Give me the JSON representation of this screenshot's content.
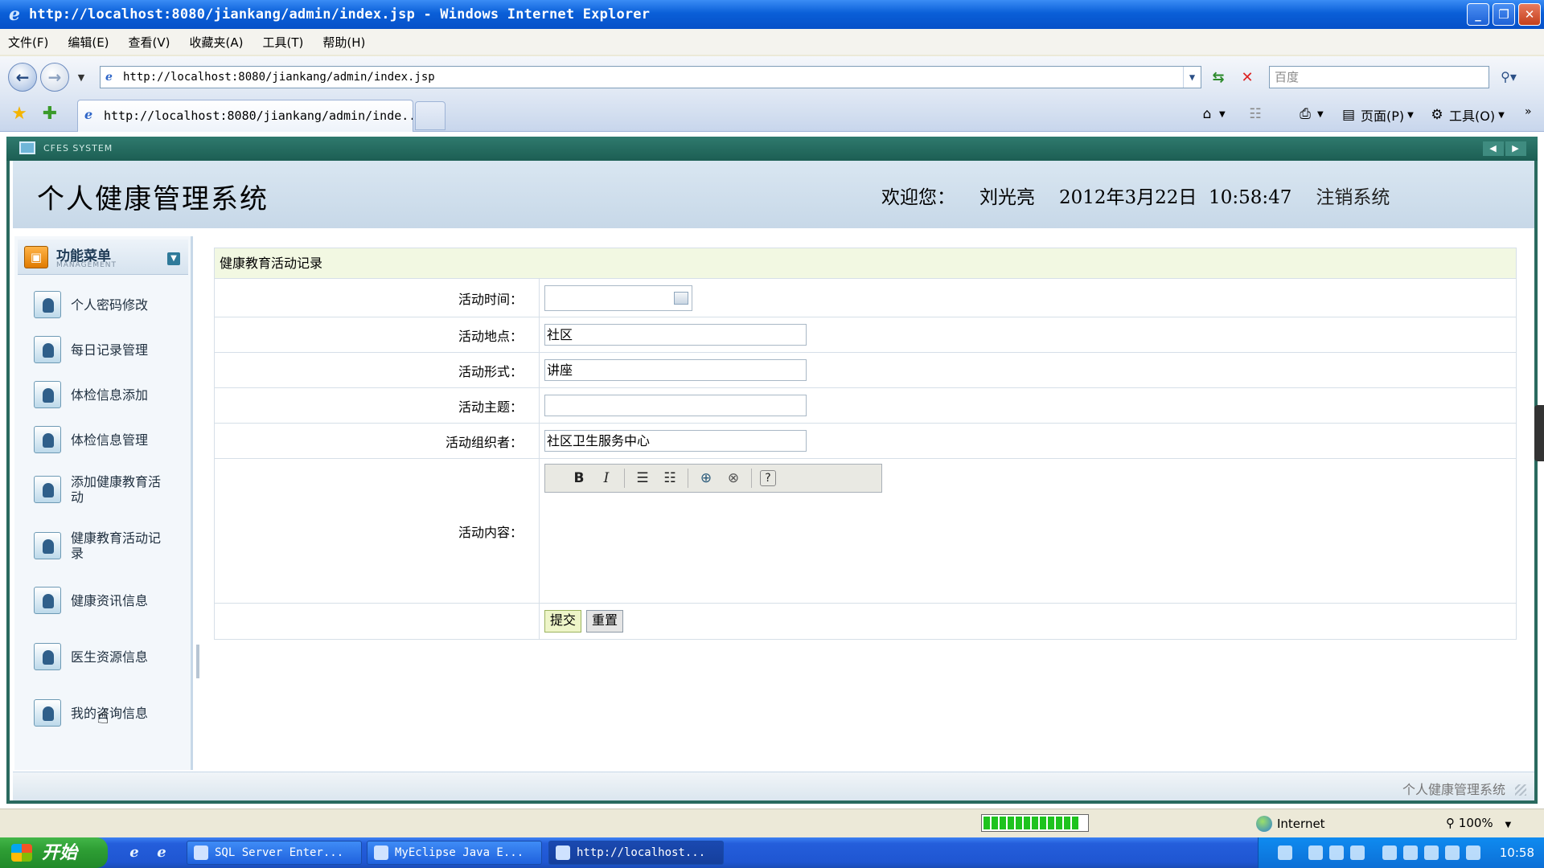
{
  "window": {
    "title": "http://localhost:8080/jiankang/admin/index.jsp - Windows Internet Explorer",
    "icon": "ie-icon"
  },
  "menubar": [
    "文件(F)",
    "编辑(E)",
    "查看(V)",
    "收藏夹(A)",
    "工具(T)",
    "帮助(H)"
  ],
  "address": {
    "url": "http://localhost:8080/jiankang/admin/index.jsp",
    "search_placeholder": "百度"
  },
  "tab": {
    "label": "http://localhost:8080/jiankang/admin/inde..."
  },
  "commandbar": {
    "page": "页面(P)",
    "tools": "工具(O)"
  },
  "banner": "CFES SYSTEM",
  "header": {
    "title": "个人健康管理系统",
    "welcome_label": "欢迎您：",
    "user": "刘光亮",
    "datetime": "2012年3月22日  10:58:47",
    "logout": "注销系统"
  },
  "sidebar": {
    "title": "功能菜单",
    "subtitle": "MANAGEMENT",
    "items": [
      {
        "label": "个人密码修改"
      },
      {
        "label": "每日记录管理"
      },
      {
        "label": "体检信息添加"
      },
      {
        "label": "体检信息管理"
      },
      {
        "label": "添加健康教育活动"
      },
      {
        "label": "健康教育活动记录"
      },
      {
        "label": "健康资讯信息"
      },
      {
        "label": "医生资源信息"
      },
      {
        "label": "我的咨询信息"
      }
    ]
  },
  "form": {
    "heading": "健康教育活动记录",
    "fields": {
      "time": {
        "label": "活动时间：",
        "value": ""
      },
      "place": {
        "label": "活动地点：",
        "value": "社区"
      },
      "format": {
        "label": "活动形式：",
        "value": "讲座"
      },
      "theme": {
        "label": "活动主题：",
        "value": ""
      },
      "organizer": {
        "label": "活动组织者：",
        "value": "社区卫生服务中心"
      },
      "content": {
        "label": "活动内容：",
        "value": ""
      }
    },
    "editor_toolbar": [
      "B",
      "I",
      "ordered-list",
      "unordered-list",
      "link",
      "unlink",
      "help"
    ],
    "submit": "提交",
    "reset": "重置"
  },
  "footer": "个人健康管理系统",
  "statusbar": {
    "zone": "Internet",
    "zoom": "100%"
  },
  "taskbar": {
    "start": "开始",
    "tasks": [
      "SQL Server Enter...",
      "MyEclipse Java E...",
      "http://localhost..."
    ],
    "clock": "10:58"
  }
}
